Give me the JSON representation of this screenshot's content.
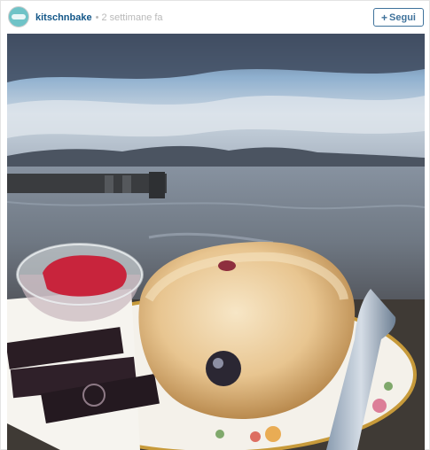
{
  "post": {
    "username": "kitschnbake",
    "separator": "•",
    "timestamp": "2 settimane fa",
    "follow_label": "Segui",
    "follow_icon": "+"
  },
  "photo": {
    "subject": "scone with jam and chocolates on a plate by the waterside"
  },
  "colors": {
    "username": "#125688",
    "follow_button": "#3f729b",
    "avatar": "#6fc3c7"
  }
}
